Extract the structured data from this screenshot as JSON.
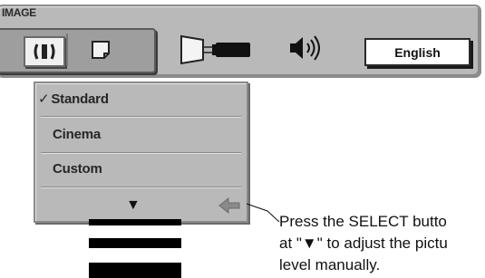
{
  "menu": {
    "title": "IMAGE",
    "icons": [
      "image-mode-icon",
      "screen-icon",
      "projector-icon",
      "speaker-icon"
    ],
    "language_label": "English"
  },
  "dropdown": {
    "items": [
      {
        "label": "Standard",
        "checked": true
      },
      {
        "label": "Cinema",
        "checked": false
      },
      {
        "label": "Custom",
        "checked": false
      }
    ],
    "check_glyph": "✓",
    "down_glyph": "▼"
  },
  "callout": {
    "lines": [
      "Press the SELECT butto",
      "at \"▼\" to adjust the pictu",
      "level manually."
    ]
  },
  "colors": {
    "panel": "#b9b9b9",
    "panel_border": "#8a8a8a",
    "text": "#262626"
  }
}
